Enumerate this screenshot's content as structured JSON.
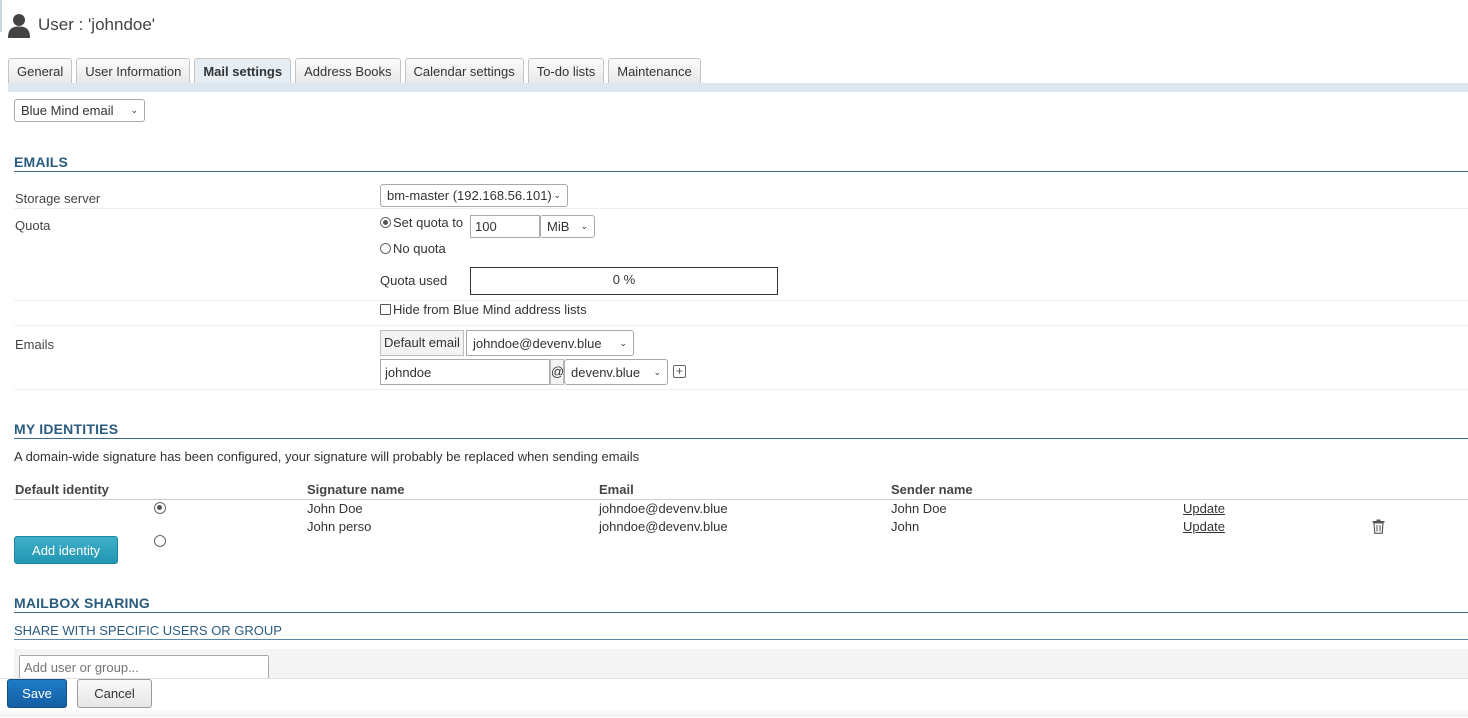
{
  "header": {
    "title": "User : 'johndoe'"
  },
  "tabs": [
    {
      "label": "General"
    },
    {
      "label": "User Information"
    },
    {
      "label": "Mail settings"
    },
    {
      "label": "Address Books"
    },
    {
      "label": "Calendar settings"
    },
    {
      "label": "To-do lists"
    },
    {
      "label": "Maintenance"
    }
  ],
  "mail_type_select": {
    "value": "Blue Mind email"
  },
  "emails_section": {
    "heading": "EMAILS",
    "storage_server": {
      "label": "Storage server",
      "value": "bm-master (192.168.56.101)"
    },
    "quota": {
      "label": "Quota",
      "set_quota_label": "Set quota to",
      "quota_value": "100",
      "unit": "MiB",
      "no_quota_label": "No quota",
      "quota_used_label": "Quota used",
      "quota_used_value": "0 %",
      "quota_used_fraction": 0
    },
    "hide_label": "Hide from Blue Mind address lists",
    "emails": {
      "label": "Emails",
      "default_email_label": "Default email",
      "default_email_value": "johndoe@devenv.blue",
      "local_part": "johndoe",
      "at_sign": "@",
      "domain": "devenv.blue"
    }
  },
  "identities_section": {
    "heading": "MY IDENTITIES",
    "notice": "A domain-wide signature has been configured, your signature will probably be replaced when sending emails",
    "columns": {
      "default_identity": "Default identity",
      "signature_name": "Signature name",
      "email": "Email",
      "sender_name": "Sender name"
    },
    "rows": [
      {
        "signature_name": "John Doe",
        "email": "johndoe@devenv.blue",
        "sender_name": "John Doe",
        "action": "Update",
        "default": true
      },
      {
        "signature_name": "John perso",
        "email": "johndoe@devenv.blue",
        "sender_name": "John",
        "action": "Update",
        "default": false
      }
    ],
    "add_button": "Add identity"
  },
  "sharing_section": {
    "heading": "MAILBOX SHARING",
    "subheading": "SHARE WITH SPECIFIC USERS OR GROUP",
    "add_placeholder": "Add user or group..."
  },
  "footer": {
    "save": "Save",
    "cancel": "Cancel"
  }
}
